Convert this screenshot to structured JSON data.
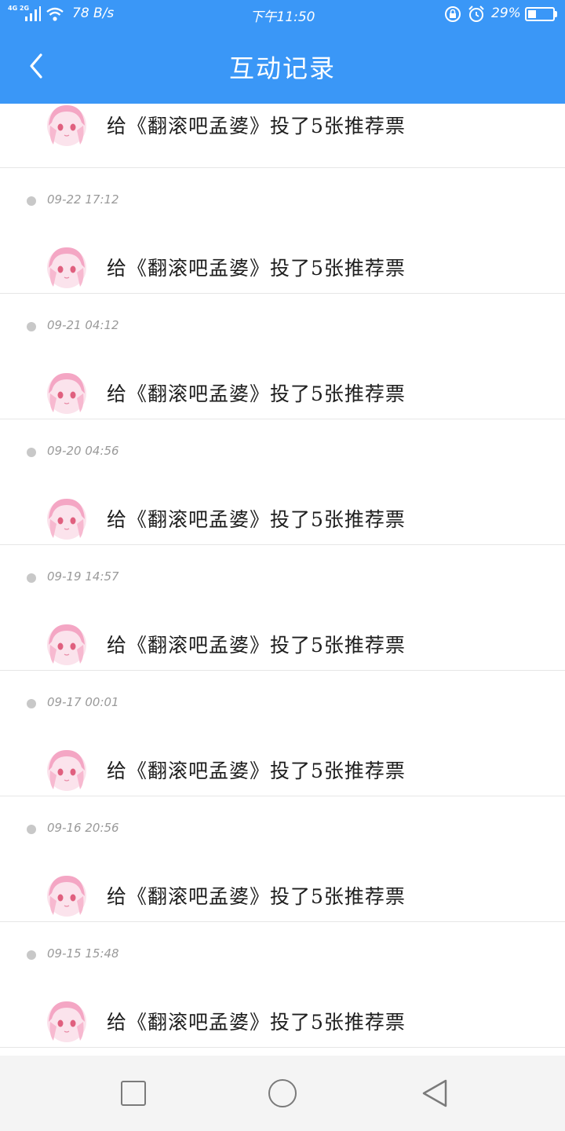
{
  "status_bar": {
    "network": "4G 2G",
    "net_speed": "78 B/s",
    "time": "下午11:50",
    "battery": "29%"
  },
  "header": {
    "title": "互动记录",
    "back_icon": "chevron-left-icon"
  },
  "records": [
    {
      "time": "",
      "text": "给《翻滚吧孟婆》投了5张推荐票"
    },
    {
      "time": "09-22 17:12",
      "text": "给《翻滚吧孟婆》投了5张推荐票"
    },
    {
      "time": "09-21 04:12",
      "text": "给《翻滚吧孟婆》投了5张推荐票"
    },
    {
      "time": "09-20 04:56",
      "text": "给《翻滚吧孟婆》投了5张推荐票"
    },
    {
      "time": "09-19 14:57",
      "text": "给《翻滚吧孟婆》投了5张推荐票"
    },
    {
      "time": "09-17 00:01",
      "text": "给《翻滚吧孟婆》投了5张推荐票"
    },
    {
      "time": "09-16 20:56",
      "text": "给《翻滚吧孟婆》投了5张推荐票"
    },
    {
      "time": "09-15 15:48",
      "text": "给《翻滚吧孟婆》投了5张推荐票"
    }
  ],
  "colors": {
    "accent": "#3a97f7",
    "divider": "#e6e6e6",
    "timestamp": "#9a9a9a",
    "avatar_pink": "#f4a6c4"
  },
  "bottom_nav": {
    "icons": [
      "square-recent-apps-icon",
      "circle-home-icon",
      "triangle-back-icon"
    ]
  }
}
